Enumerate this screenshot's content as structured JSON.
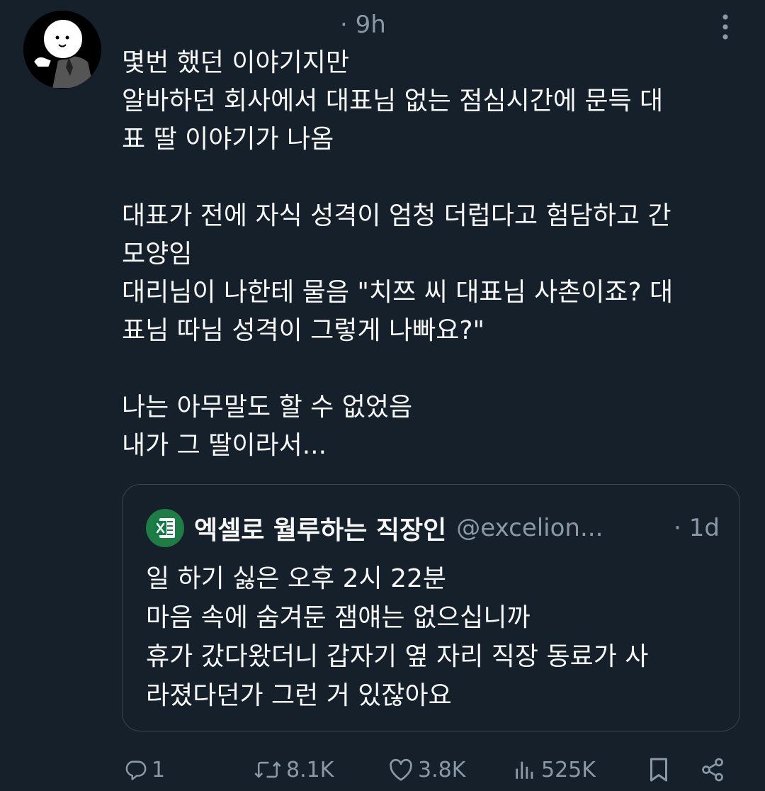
{
  "post": {
    "time": "· 9h",
    "text_lines": [
      "몇번 했던 이야기지만",
      "알바하던 회사에서 대표님 없는 점심시간에 문득 대",
      "표 딸 이야기가 나옴",
      "",
      "대표가 전에 자식 성격이 엄청 더럽다고 험담하고 간",
      "모양임",
      "대리님이 나한테 물음 \"치쯔 씨 대표님 사촌이죠? 대",
      "표님 따님 성격이 그렇게 나빠요?\"",
      "",
      "나는 아무말도 할 수 없었음",
      "내가 그 딸이라서..."
    ]
  },
  "quote": {
    "name": "엑셀로 월루하는 직장인",
    "handle": "@excelion...",
    "time": "· 1d",
    "text_lines": [
      "일 하기 싫은 오후 2시 22분",
      "마음 속에 숨겨둔 잼얘는 없으십니까",
      "휴가 갔다왔더니 갑자기 옆 자리 직장 동료가 사",
      "라졌다던가 그런 거 있잖아요"
    ]
  },
  "actions": {
    "replies": "1",
    "reposts": "8.1K",
    "likes": "3.8K",
    "views": "525K"
  },
  "icons": [
    "avatar-doodle",
    "more-icon",
    "excel-icon",
    "reply-icon",
    "repost-icon",
    "like-icon",
    "views-icon",
    "bookmark-icon",
    "share-icon"
  ],
  "colors": {
    "background": "#15202b",
    "text": "#f7f9f9",
    "muted": "#8b98a5",
    "border": "#38444d",
    "excel_green": "#1e7d45"
  }
}
